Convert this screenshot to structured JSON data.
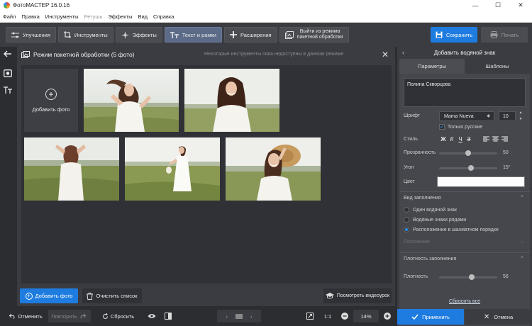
{
  "window": {
    "title": "ФотоМАСТЕР 16.0.16",
    "minimize": "—",
    "maximize": "☐",
    "close": "✕"
  },
  "menu": [
    {
      "label": "Файл",
      "enabled": true
    },
    {
      "label": "Правка",
      "enabled": true
    },
    {
      "label": "Инструменты",
      "enabled": true
    },
    {
      "label": "Ретушь",
      "enabled": false
    },
    {
      "label": "Эффекты",
      "enabled": true
    },
    {
      "label": "Вид",
      "enabled": true
    },
    {
      "label": "Справка",
      "enabled": true
    }
  ],
  "toolbar": {
    "tabs": [
      {
        "label": "Улучшения",
        "icon": "sliders-icon"
      },
      {
        "label": "Инструменты",
        "icon": "crop-icon"
      },
      {
        "label": "Эффекты",
        "icon": "sparkle-icon"
      },
      {
        "label": "Текст и рамки",
        "icon": "text-icon"
      },
      {
        "label": "Расширения",
        "icon": "plus-icon"
      }
    ],
    "active_tab": "Текст и рамки",
    "exit_line1": "Выйти из режима",
    "exit_line2": "пакетной обработки",
    "save": "Сохранить",
    "print": "Печать"
  },
  "canvas": {
    "title": "Режим пакетной обработки (5 фото)",
    "note": "Некоторые инструменты пока недоступны в данном режиме",
    "close": "✕",
    "add_tile_label": "Добавить фото",
    "photo_count": 5,
    "add_photo_btn": "Добавить фото",
    "clear_list_btn": "Очистить список",
    "video_btn": "Посмотреть видеоурок"
  },
  "statusbar": {
    "undo": "Отменить",
    "redo": "Повторить",
    "reset": "Сбросить",
    "ratio": "1:1",
    "zoom": "14%"
  },
  "watermark_panel": {
    "title": "Добавить водяной знак",
    "tabs": [
      "Параметры",
      "Шаблоны"
    ],
    "active_tab": "Параметры",
    "text_value": "Полина Скворцова",
    "font_label": "Шрифт",
    "font_value": "Mama Nueva",
    "font_size": "10",
    "only_russian": "Только русские",
    "style_label": "Стиль",
    "style_buttons": [
      "Ж",
      "К",
      "Ч",
      "З"
    ],
    "transparency_label": "Прозрачность",
    "transparency_value": "50",
    "transparency_level": 0.5,
    "angle_label": "Угол",
    "angle_value": "15°",
    "angle_level": 0.55,
    "color_label": "Цвет",
    "color_value": "#ffffff",
    "fill_section": "Вид заполнения",
    "fill_options": [
      {
        "label": "Один водяной знак",
        "selected": false
      },
      {
        "label": "Водяные знаки рядами",
        "selected": false
      },
      {
        "label": "Расположение в шахматном порядке",
        "selected": true
      }
    ],
    "position_section": "Положение",
    "density_section": "Плотность заполнения",
    "density_label": "Плотность",
    "density_value": "56",
    "density_level": 0.56,
    "reset_all": "Сбросить все",
    "apply": "Применить",
    "cancel": "Отмена"
  },
  "colors": {
    "accent": "#1e7ce0",
    "panel": "#3a3c41",
    "background": "#2b2d31"
  }
}
